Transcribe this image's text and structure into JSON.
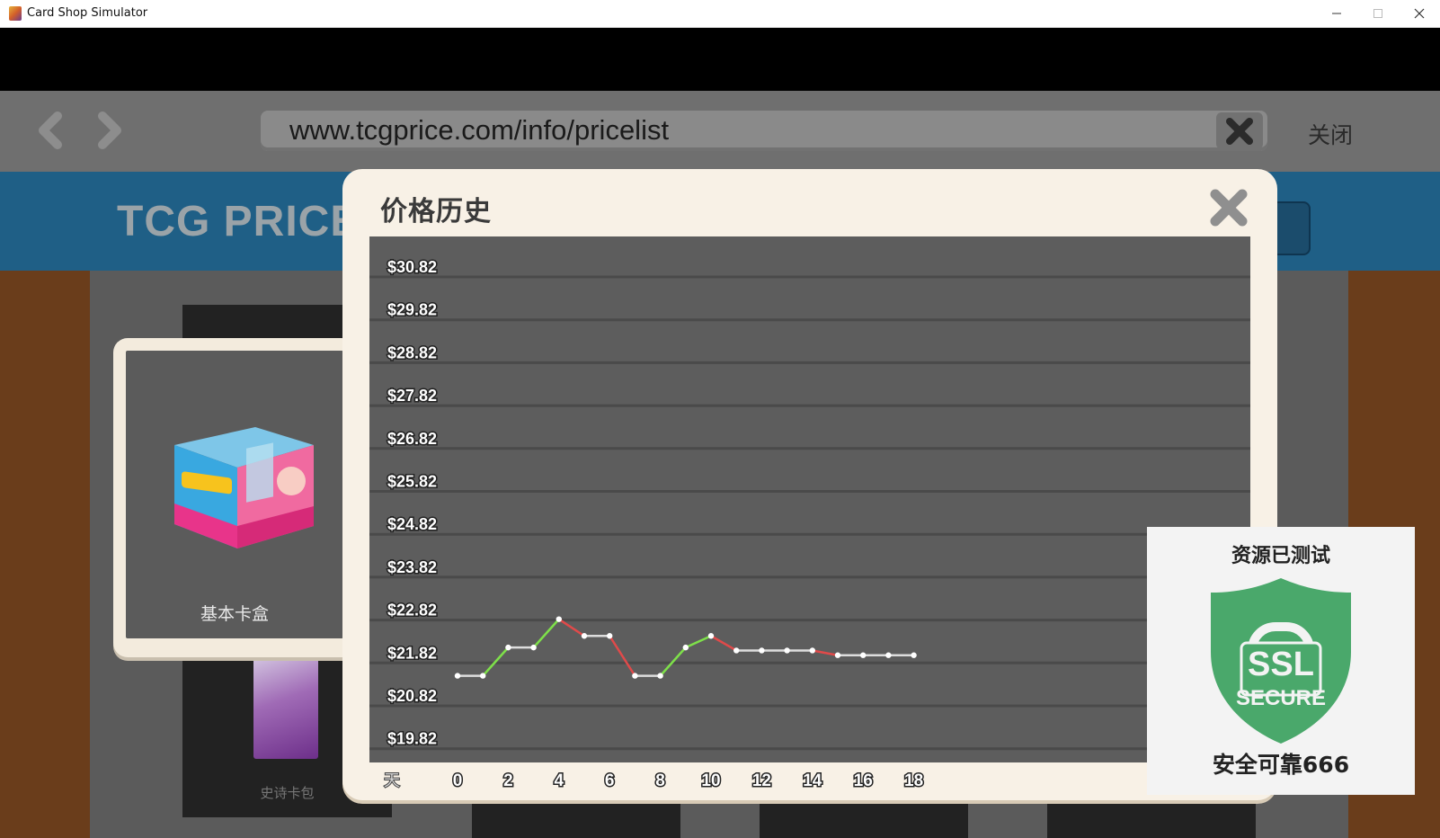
{
  "window": {
    "title": "Card Shop Simulator",
    "icon": "app-icon"
  },
  "browser": {
    "url": "www.tcgprice.com/info/pricelist",
    "close_label": "关闭"
  },
  "site": {
    "logo_text": "TCG PRICE"
  },
  "product": {
    "name": "基本卡盒"
  },
  "background_items": [
    {
      "label": "史诗卡包"
    }
  ],
  "modal": {
    "title": "价格历史",
    "x_axis_prefix": "天"
  },
  "chart_data": {
    "type": "line",
    "y_ticks": [
      "$30.82",
      "$29.82",
      "$28.82",
      "$27.82",
      "$26.82",
      "$25.82",
      "$24.82",
      "$23.82",
      "$22.82",
      "$21.82",
      "$20.82",
      "$19.82"
    ],
    "x_ticks": [
      "0",
      "2",
      "4",
      "6",
      "8",
      "10",
      "12",
      "14",
      "16",
      "18"
    ],
    "ylim": [
      19.82,
      30.82
    ],
    "xlim": [
      0,
      18
    ],
    "x": [
      0,
      1,
      2,
      3,
      4,
      5,
      6,
      7,
      8,
      9,
      10,
      11,
      12,
      13,
      14,
      15,
      16,
      17,
      18
    ],
    "values": [
      21.52,
      21.52,
      22.18,
      22.18,
      22.84,
      22.45,
      22.45,
      21.52,
      21.52,
      22.18,
      22.45,
      22.11,
      22.11,
      22.11,
      22.11,
      22.0,
      22.0,
      22.0,
      22.0
    ],
    "colors": {
      "up": "#7ee04a",
      "down": "#e04a4a",
      "flat": "#dddddd",
      "point": "#ffffff"
    },
    "grid": true
  },
  "ssl_badge": {
    "top_text": "资源已测试",
    "shield_line1": "SSL",
    "shield_line2": "SECURE",
    "bottom_text": "安全可靠666",
    "shield_color": "#4aa86b"
  }
}
